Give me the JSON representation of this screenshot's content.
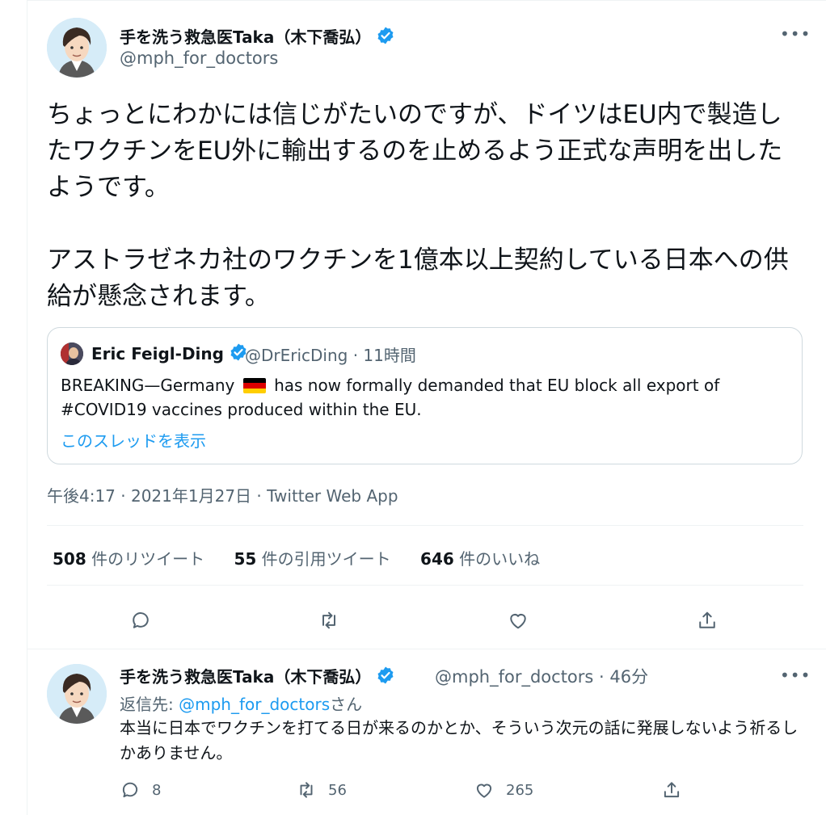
{
  "tweet": {
    "author_name": "手を洗う救急医Taka（木下喬弘）",
    "author_handle": "@mph_for_doctors",
    "more_label": "•••",
    "text": "ちょっとにわかには信じがたいのですが、ドイツはEU内で製造したワクチンをEU外に輸出するのを止めるよう正式な声明を出したようです。\n\nアストラゼネカ社のワクチンを1億本以上契約している日本への供給が懸念されます。",
    "timestamp": "午後4:17 · 2021年1月27日 · Twitter Web App",
    "stats": {
      "retweets_count": "508",
      "retweets_label": "件のリツイート",
      "quotes_count": "55",
      "quotes_label": "件の引用ツイート",
      "likes_count": "646",
      "likes_label": "件のいいね"
    }
  },
  "quote": {
    "author_name": "Eric Feigl-Ding",
    "meta": "@DrEricDing · 11時間",
    "text_before_flag": "BREAKING—Germany",
    "text_after_flag": "has now formally demanded that EU block all export of #COVID19 vaccines produced within the EU.",
    "show_thread": "このスレッドを表示",
    "flag_colors": [
      "#000000",
      "#dd0000",
      "#ffce00"
    ]
  },
  "reply": {
    "author_name": "手を洗う救急医Taka（木下喬弘）",
    "meta": "@mph_for_doctors · 46分",
    "reply_to_prefix": "返信先: ",
    "reply_to_handle": "@mph_for_doctors",
    "reply_to_suffix": "さん",
    "more_label": "•••",
    "text": "本当に日本でワクチンを打てる日が来るのかとか、そういう次元の話に発展しないよう祈るしかありません。",
    "reply_count": "8",
    "retweet_count": "56",
    "like_count": "265"
  },
  "icons": {
    "verified": "verified-badge-icon",
    "reply": "reply-icon",
    "retweet": "retweet-icon",
    "like": "heart-icon",
    "share": "share-icon"
  },
  "colors": {
    "accent": "#1d9bf0",
    "secondary_text": "#536471",
    "border": "#cfd9de"
  }
}
